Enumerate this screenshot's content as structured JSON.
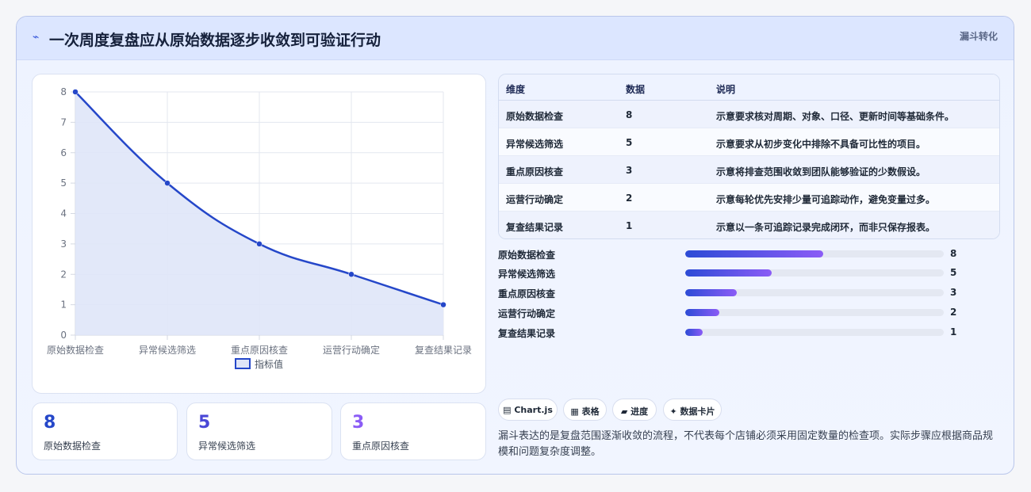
{
  "header": {
    "title": "一次周度复盘应从原始数据逐步收敛到可验证行动",
    "tag": "漏斗转化"
  },
  "chart_data": {
    "type": "line",
    "categories": [
      "原始数据检查",
      "异常候选筛选",
      "重点原因核查",
      "运营行动确定",
      "复查结果记录"
    ],
    "series": [
      {
        "name": "指标值",
        "values": [
          8,
          5,
          3,
          2,
          1
        ]
      }
    ],
    "ylim": [
      0,
      8
    ],
    "yticks": [
      "0",
      "1",
      "2",
      "3",
      "4",
      "5",
      "6",
      "7",
      "8"
    ],
    "grid": true,
    "fill": true,
    "legend": "bottom",
    "colors": {
      "line": "#2547c9",
      "fill": "#dfe5f8"
    }
  },
  "stats": [
    {
      "value": "8",
      "label": "原始数据检查",
      "color": "#2547c9"
    },
    {
      "value": "5",
      "label": "异常候选筛选",
      "color": "#4a47d6"
    },
    {
      "value": "3",
      "label": "重点原因核查",
      "color": "#8b5cf6"
    }
  ],
  "table": {
    "headers": [
      "维度",
      "数据",
      "说明"
    ],
    "rows": [
      [
        "原始数据检查",
        "8",
        "示意要求核对周期、对象、口径、更新时间等基础条件。"
      ],
      [
        "异常候选筛选",
        "5",
        "示意要求从初步变化中排除不具备可比性的项目。"
      ],
      [
        "重点原因核查",
        "3",
        "示意将排查范围收敛到团队能够验证的少数假设。"
      ],
      [
        "运营行动确定",
        "2",
        "示意每轮优先安排少量可追踪动作，避免变量过多。"
      ],
      [
        "复查结果记录",
        "1",
        "示意以一条可追踪记录完成闭环，而非只保存报表。"
      ]
    ]
  },
  "progress": {
    "max": 15,
    "items": [
      {
        "label": "原始数据检查",
        "value": 8
      },
      {
        "label": "异常候选筛选",
        "value": 5
      },
      {
        "label": "重点原因核查",
        "value": 3
      },
      {
        "label": "运营行动确定",
        "value": 2
      },
      {
        "label": "复查结果记录",
        "value": 1
      }
    ]
  },
  "chips": [
    {
      "icon": "chart-icon",
      "glyph": "▤",
      "label": "Chart.js"
    },
    {
      "icon": "table-icon",
      "glyph": "▦",
      "label": "表格"
    },
    {
      "icon": "progress-icon",
      "glyph": "▰",
      "label": "进度"
    },
    {
      "icon": "sparkle-icon",
      "glyph": "✦",
      "label": "数据卡片"
    }
  ],
  "note": "漏斗表达的是复盘范围逐渐收敛的流程，不代表每个店铺必须采用固定数量的检查项。实际步骤应根据商品规模和问题复杂度调整。"
}
